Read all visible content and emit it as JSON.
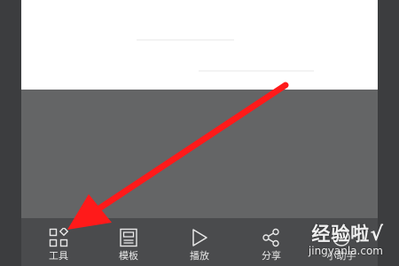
{
  "toolbar": {
    "items": [
      {
        "label": "工具",
        "icon": "grid-icon"
      },
      {
        "label": "模板",
        "icon": "template-icon"
      },
      {
        "label": "播放",
        "icon": "play-icon"
      },
      {
        "label": "分享",
        "icon": "share-icon"
      },
      {
        "label": "小助手",
        "icon": "assistant-icon"
      }
    ]
  },
  "annotation": {
    "arrow_color": "#ff1a1a",
    "target": "工具"
  },
  "watermark": {
    "main": "经验啦",
    "check": "√",
    "sub": "jingyanla.com"
  }
}
